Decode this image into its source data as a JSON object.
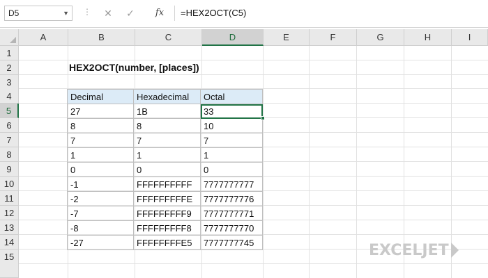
{
  "formula_bar": {
    "name_box": "D5",
    "cancel_symbol": "✕",
    "enter_symbol": "✓",
    "fx_label": "fx",
    "formula": "=HEX2OCT(C5)"
  },
  "columns": [
    "A",
    "B",
    "C",
    "D",
    "E",
    "F",
    "G",
    "H",
    "I"
  ],
  "rows": [
    "1",
    "2",
    "3",
    "4",
    "5",
    "6",
    "7",
    "8",
    "9",
    "10",
    "11",
    "12",
    "13",
    "14",
    "15"
  ],
  "active_cell": "D5",
  "title": "HEX2OCT(number, [places])",
  "table": {
    "headers": [
      "Decimal",
      "Hexadecimal",
      "Octal"
    ],
    "rows": [
      [
        "27",
        "1B",
        "33"
      ],
      [
        "8",
        "8",
        "10"
      ],
      [
        "7",
        "7",
        "7"
      ],
      [
        "1",
        "1",
        "1"
      ],
      [
        "0",
        "0",
        "0"
      ],
      [
        "-1",
        "FFFFFFFFFF",
        "7777777777"
      ],
      [
        "-2",
        "FFFFFFFFFE",
        "7777777776"
      ],
      [
        "-7",
        "FFFFFFFFF9",
        "7777777771"
      ],
      [
        "-8",
        "FFFFFFFFF8",
        "7777777770"
      ],
      [
        "-27",
        "FFFFFFFFE5",
        "7777777745"
      ]
    ]
  },
  "logo": {
    "text": "EXCELJET"
  },
  "colors": {
    "accent": "#217346",
    "header_fill": "#dcebf7",
    "logo": "#c9c9c9"
  }
}
